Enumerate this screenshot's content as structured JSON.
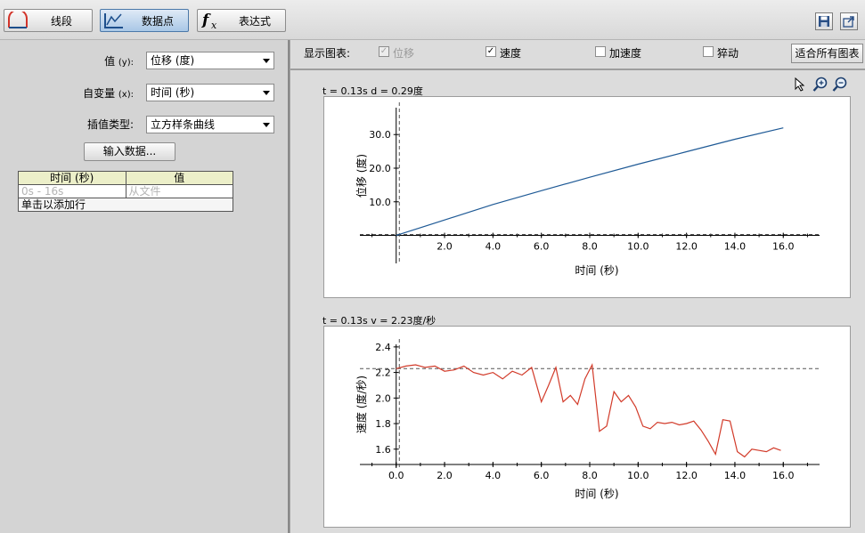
{
  "toolbar": {
    "buttons": [
      {
        "label": "线段",
        "icon": "arc-segment-icon"
      },
      {
        "label": "数据点",
        "icon": "datapoints-chart-icon"
      },
      {
        "label": "表达式",
        "icon": "function-fx-icon"
      }
    ],
    "fx_text": "fx",
    "save_icon": "save-icon",
    "export_icon": "export-icon"
  },
  "left": {
    "value_label": "值",
    "value_hint": "(y):",
    "value_select": "位移 (度)",
    "indep_label": "自变量",
    "indep_hint": "(x):",
    "indep_select": "时间 (秒)",
    "interp_label": "插值类型:",
    "interp_select": "立方样条曲线",
    "import_button": "输入数据...",
    "table": {
      "headers": [
        "时间 (秒)",
        "值"
      ],
      "row": [
        "0s - 16s",
        "从文件"
      ],
      "add_row": "单击以添加行"
    }
  },
  "right": {
    "show_label": "显示图表:",
    "checkboxes": [
      {
        "label": "位移",
        "checked": true,
        "disabled": true
      },
      {
        "label": "速度",
        "checked": true,
        "disabled": false
      },
      {
        "label": "加速度",
        "checked": false,
        "disabled": false
      },
      {
        "label": "猝动",
        "checked": false,
        "disabled": false
      }
    ],
    "fit_button": "适合所有图表",
    "tools": [
      "pointer-icon",
      "zoom-in-icon",
      "zoom-out-icon"
    ]
  },
  "chart_data": [
    {
      "type": "line",
      "readout": "t = 0.13s  d = 0.29度",
      "xlabel": "时间 (秒)",
      "ylabel": "位移 (度)",
      "xlim": [
        -1.5,
        17.5
      ],
      "ylim": [
        -2.5,
        38
      ],
      "xticks": [
        "2.0",
        "4.0",
        "6.0",
        "8.0",
        "10.0",
        "12.0",
        "14.0",
        "16.0"
      ],
      "yticks": [
        "10.0",
        "20.0",
        "30.0"
      ],
      "cursor": {
        "x": 0.13,
        "y": 0.29
      },
      "color": "#1f5a96",
      "series": [
        {
          "x": [
            0,
            2,
            4,
            6,
            8,
            10,
            12,
            14,
            16
          ],
          "y": [
            0,
            4.6,
            9.2,
            13.3,
            17.3,
            21.2,
            24.9,
            28.6,
            32.0
          ]
        }
      ]
    },
    {
      "type": "line",
      "readout": "t = 0.13s  v = 2.23度/秒",
      "xlabel": "时间 (秒)",
      "ylabel": "速度 (度/秒)",
      "xlim": [
        -1.5,
        17.5
      ],
      "ylim": [
        1.48,
        2.42
      ],
      "xticks": [
        "0.0",
        "2.0",
        "4.0",
        "6.0",
        "8.0",
        "10.0",
        "12.0",
        "14.0",
        "16.0"
      ],
      "yticks": [
        "1.6",
        "1.8",
        "2.0",
        "2.2",
        "2.4"
      ],
      "cursor": {
        "x": 0.13,
        "y": 2.23
      },
      "color": "#d23b2a",
      "series": [
        {
          "x": [
            0,
            0.4,
            0.8,
            1.2,
            1.6,
            2.0,
            2.4,
            2.8,
            3.2,
            3.6,
            4.0,
            4.4,
            4.8,
            5.2,
            5.6,
            6.0,
            6.3,
            6.6,
            6.9,
            7.2,
            7.5,
            7.8,
            8.1,
            8.4,
            8.7,
            9.0,
            9.3,
            9.6,
            9.9,
            10.2,
            10.5,
            10.8,
            11.1,
            11.4,
            11.7,
            12.0,
            12.3,
            12.6,
            12.9,
            13.2,
            13.5,
            13.8,
            14.1,
            14.4,
            14.7,
            15.0,
            15.3,
            15.6,
            15.9
          ],
          "y": [
            2.23,
            2.25,
            2.26,
            2.24,
            2.25,
            2.21,
            2.22,
            2.25,
            2.2,
            2.18,
            2.2,
            2.15,
            2.21,
            2.18,
            2.24,
            1.97,
            2.1,
            2.24,
            1.97,
            2.02,
            1.95,
            2.15,
            2.26,
            1.74,
            1.78,
            2.05,
            1.97,
            2.02,
            1.93,
            1.78,
            1.76,
            1.81,
            1.8,
            1.81,
            1.79,
            1.8,
            1.82,
            1.75,
            1.66,
            1.56,
            1.83,
            1.82,
            1.58,
            1.54,
            1.6,
            1.59,
            1.58,
            1.61,
            1.59
          ]
        }
      ]
    }
  ]
}
